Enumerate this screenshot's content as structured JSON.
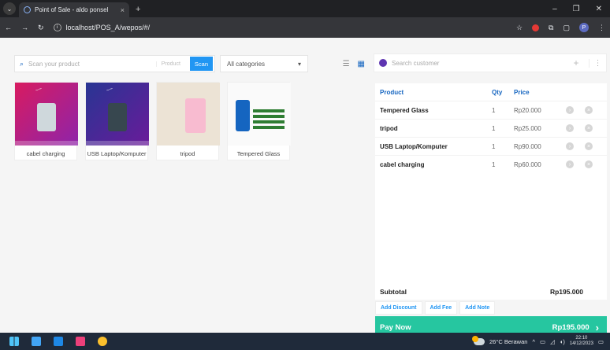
{
  "browser": {
    "tab_title": "Point of Sale - aldo ponsel",
    "url": "localhost/POS_A/wepos/#/",
    "close_glyph": "×",
    "newtab_glyph": "+"
  },
  "toolbar": {
    "search_placeholder": "Scan your product",
    "product_label": "Product",
    "scan_label": "Scan",
    "category_value": "All categories"
  },
  "products": [
    {
      "name": "cabel charging"
    },
    {
      "name": "USB Laptop/Komputer"
    },
    {
      "name": "tripod"
    },
    {
      "name": "Tempered Glass"
    }
  ],
  "customer": {
    "placeholder": "Search customer"
  },
  "cart": {
    "headers": {
      "product": "Product",
      "qty": "Qty",
      "price": "Price"
    },
    "items": [
      {
        "product": "Tempered Glass",
        "qty": "1",
        "price": "Rp20.000"
      },
      {
        "product": "tripod",
        "qty": "1",
        "price": "Rp25.000"
      },
      {
        "product": "USB Laptop/Komputer",
        "qty": "1",
        "price": "Rp90.000"
      },
      {
        "product": "cabel charging",
        "qty": "1",
        "price": "Rp60.000"
      }
    ],
    "subtotal_label": "Subtotal",
    "subtotal_value": "Rp195.000",
    "actions": {
      "discount": "Add Discount",
      "fee": "Add Fee",
      "note": "Add Note"
    },
    "pay_label": "Pay Now",
    "pay_amount": "Rp195.000"
  },
  "taskbar": {
    "weather": "26°C Berawan",
    "time": "22:10",
    "date": "14/12/2023"
  },
  "colors": {
    "accent": "#2196f3",
    "pay_button": "#26c6a0"
  },
  "icons": [
    "search-icon",
    "grid-view-icon",
    "list-view-icon",
    "user-icon",
    "plus-icon",
    "more-icon",
    "close-icon",
    "chevron-right-icon"
  ]
}
